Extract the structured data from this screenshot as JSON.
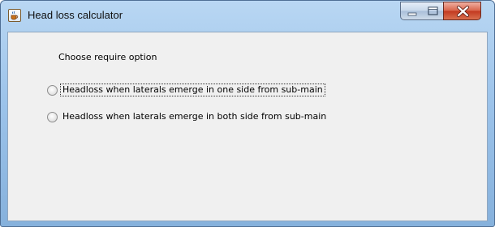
{
  "window": {
    "title": "Head loss calculator"
  },
  "controls": {
    "minimize_icon": "minimize-icon",
    "maximize_icon": "maximize-icon",
    "close_icon": "close-icon"
  },
  "content": {
    "prompt": "Choose require option",
    "options": [
      {
        "label": "Headloss when laterals emerge in one side from sub-main",
        "selected": false,
        "focused": true
      },
      {
        "label": "Headloss when laterals emerge in both side from sub-main",
        "selected": false,
        "focused": false
      }
    ]
  },
  "colors": {
    "frame": "#9cc3ea",
    "client": "#f0f0f0",
    "close_button": "#c7452b"
  }
}
